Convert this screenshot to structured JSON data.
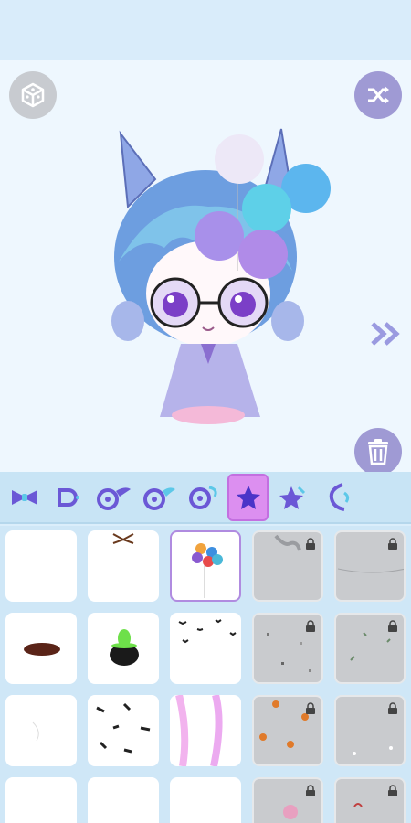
{
  "toolbar": {
    "random_icon": "dice-cube-icon",
    "shuffle_icon": "shuffle-icon",
    "next_icon": "double-chevron-right-icon",
    "delete_icon": "trash-icon"
  },
  "categories": [
    {
      "icon": "bow-icon",
      "active": false
    },
    {
      "icon": "hair-clip-icon",
      "active": false
    },
    {
      "icon": "wing-right-icon",
      "active": false
    },
    {
      "icon": "wing-left-icon",
      "active": false
    },
    {
      "icon": "halo-ring-icon",
      "active": false
    },
    {
      "icon": "star-icon",
      "active": true
    },
    {
      "icon": "star-sparkle-icon",
      "active": false
    },
    {
      "icon": "swirl-icon",
      "active": false
    }
  ],
  "items": [
    {
      "item": "none",
      "locked": false
    },
    {
      "item": "brown-bow-item",
      "locked": false
    },
    {
      "item": "balloons-item",
      "locked": false,
      "selected": true
    },
    {
      "item": "hand-item",
      "locked": true
    },
    {
      "item": "thread-item",
      "locked": true
    },
    {
      "item": "brown-wreath-item",
      "locked": false
    },
    {
      "item": "cauldron-item",
      "locked": false
    },
    {
      "item": "bats-item",
      "locked": false
    },
    {
      "item": "confetti-item",
      "locked": true
    },
    {
      "item": "leaves-item",
      "locked": true
    },
    {
      "item": "sketch-item",
      "locked": false
    },
    {
      "item": "feathers-item",
      "locked": false
    },
    {
      "item": "pink-flames-item",
      "locked": false
    },
    {
      "item": "fire-item",
      "locked": true
    },
    {
      "item": "sparkle-item",
      "locked": true
    },
    {
      "item": "none",
      "locked": false
    },
    {
      "item": "none",
      "locked": false
    },
    {
      "item": "none",
      "locked": false
    },
    {
      "item": "pink-balloon-item",
      "locked": true
    },
    {
      "item": "petal-item",
      "locked": true
    }
  ],
  "colors": {
    "accent": "#9f9ad4",
    "active_tab": "#dc8ff0",
    "background": "#eef7fe"
  }
}
